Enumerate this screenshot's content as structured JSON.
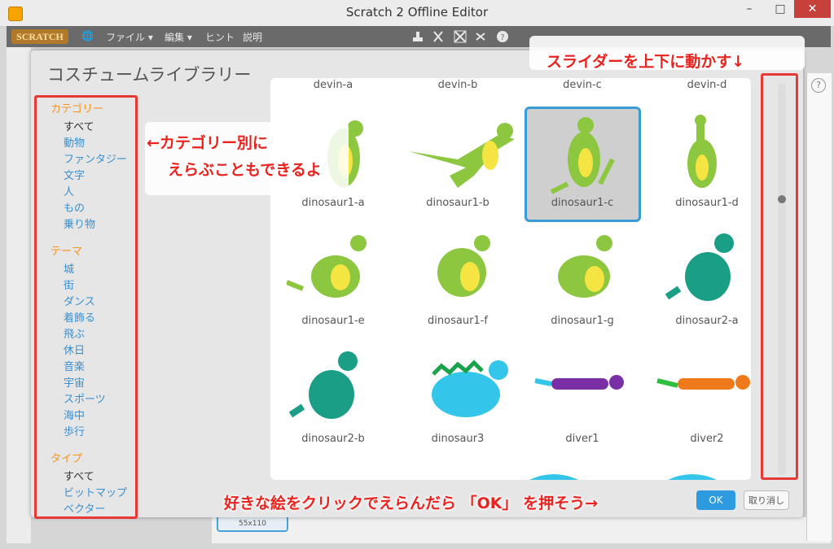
{
  "window": {
    "title": "Scratch 2 Offline Editor",
    "minimize": "–",
    "maximize": "□",
    "close": "✕"
  },
  "menubar": {
    "logo": "SCRATCH",
    "globe_icon": "🌐",
    "items": [
      "ファイル ▾",
      "編集 ▾",
      "ヒント",
      "説明"
    ]
  },
  "toolbar_icons": [
    "stamp-icon",
    "cut-icon",
    "grow-icon",
    "shrink-icon",
    "help-icon"
  ],
  "dialog": {
    "title": "コスチュームライブラリー",
    "categories": {
      "head": "カテゴリー",
      "items": [
        "すべて",
        "動物",
        "ファンタジー",
        "文字",
        "人",
        "もの",
        "乗り物"
      ]
    },
    "themes": {
      "head": "テーマ",
      "items": [
        "城",
        "街",
        "ダンス",
        "着飾る",
        "飛ぶ",
        "休日",
        "音楽",
        "宇宙",
        "スポーツ",
        "海中",
        "歩行"
      ]
    },
    "types": {
      "head": "タイプ",
      "items": [
        "すべて",
        "ビットマップ",
        "ベクター"
      ]
    },
    "costumes": [
      "devin-a",
      "devin-b",
      "devin-c",
      "devin-d",
      "dinosaur1-a",
      "dinosaur1-b",
      "dinosaur1-c",
      "dinosaur1-d",
      "dinosaur1-e",
      "dinosaur1-f",
      "dinosaur1-g",
      "dinosaur2-a",
      "dinosaur2-b",
      "dinosaur3",
      "diver1",
      "diver2"
    ],
    "selected_costume": "dinosaur1-c",
    "ok_label": "OK",
    "cancel_label": "取り消し"
  },
  "annotations": {
    "category_line1": "←カテゴリー別に",
    "category_line2": "えらぶこともできるよ",
    "slider": "スライダーを上下に動かす↓",
    "ok_hint": "好きな絵をクリックでえらんだら 「OK」 を押そう→"
  },
  "background": {
    "thumb_size": "55x110",
    "help_icon": "?"
  },
  "colors": {
    "annotation": "#e8231f",
    "category_link": "#3a8fd0",
    "category_head": "#f7931e",
    "ok_button": "#2e9be0",
    "selection_border": "#3a9bd6"
  }
}
